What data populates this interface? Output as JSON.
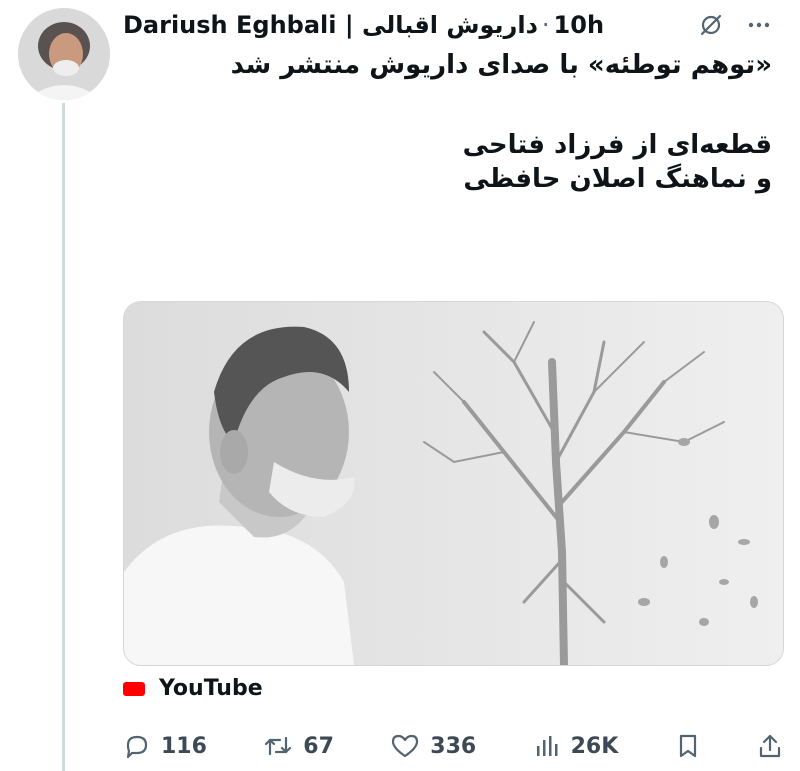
{
  "post": {
    "display_name": "Dariush Eghbali | داریوش اقبالی",
    "separator": "·",
    "time": "10h",
    "lines": [
      "«توهم توطئه» با صدای داریوش منتشر شد",
      "قطعه‌ای از فرزاد فتاحی",
      "و نماهنگ اصلان حافظی"
    ]
  },
  "link_card": {
    "source": "YouTube"
  },
  "actions": {
    "replies": "116",
    "reposts": "67",
    "likes": "336",
    "views": "26K"
  },
  "icons": {
    "header": [
      "grok-icon",
      "more-icon"
    ],
    "actions": [
      "reply-icon",
      "repost-icon",
      "like-icon",
      "views-icon",
      "bookmark-icon",
      "share-icon"
    ]
  },
  "colors": {
    "text": "#0f1419",
    "muted": "#536471",
    "youtube": "#ff0000",
    "thread_line": "#cfd9de"
  }
}
